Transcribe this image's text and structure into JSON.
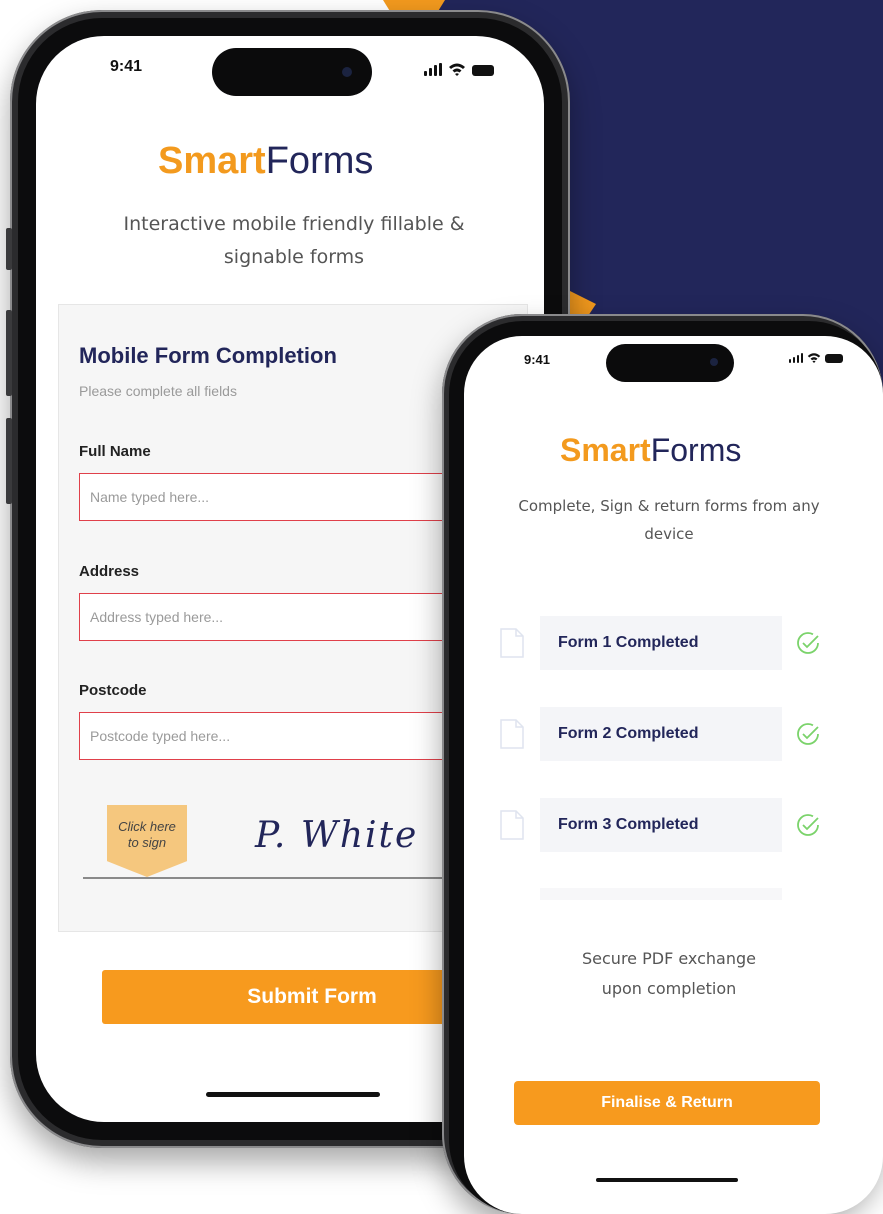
{
  "colors": {
    "brand_orange": "#f39a1e",
    "brand_navy": "#22265a",
    "field_border_red": "#e0404a"
  },
  "phone1": {
    "status": {
      "time": "9:41"
    },
    "brand": {
      "part1": "Smart",
      "part2": "Forms"
    },
    "tagline": "Interactive mobile friendly fillable & signable forms",
    "card": {
      "title": "Mobile Form Completion",
      "subtitle": "Please complete all fields",
      "fields": [
        {
          "label": "Full Name",
          "placeholder": "Name typed here..."
        },
        {
          "label": "Address",
          "placeholder": "Address typed here..."
        },
        {
          "label": "Postcode",
          "placeholder": "Postcode typed here..."
        }
      ],
      "sign_tag": {
        "line1": "Click here",
        "line2": "to sign"
      },
      "signature": "P. White"
    },
    "submit_label": "Submit Form"
  },
  "phone2": {
    "status": {
      "time": "9:41"
    },
    "brand": {
      "part1": "Smart",
      "part2": "Forms"
    },
    "tagline": "Complete, Sign & return forms from any device",
    "forms": [
      {
        "label": "Form 1 Completed",
        "icon": "document-icon",
        "status_icon": "check-circle-icon"
      },
      {
        "label": "Form 2 Completed",
        "icon": "document-icon",
        "status_icon": "check-circle-icon"
      },
      {
        "label": "Form 3 Completed",
        "icon": "document-icon",
        "status_icon": "check-circle-icon"
      }
    ],
    "secure_text": {
      "line1": "Secure PDF exchange",
      "line2": "upon completion"
    },
    "finalise_label": "Finalise & Return"
  }
}
